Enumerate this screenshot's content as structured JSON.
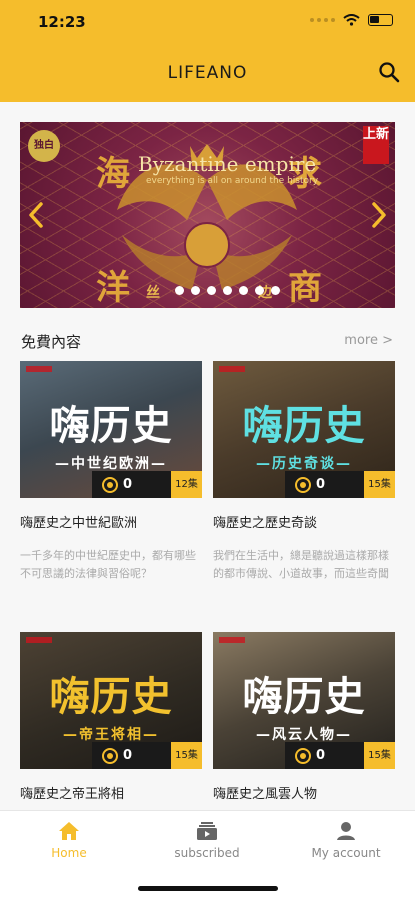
{
  "status_bar": {
    "time": "12:23"
  },
  "header": {
    "title": "LIFEANO"
  },
  "banner": {
    "title": "Byzantine empire",
    "subtitle": "everything is all on around the history",
    "chars": [
      "海",
      "求",
      "洋",
      "商"
    ],
    "small_left": "丝",
    "small_right": "边",
    "new_badge": "上新",
    "logo_text": "独白"
  },
  "section": {
    "title": "免費內容",
    "more": "more >"
  },
  "cards": [
    {
      "thumb_main": "嗨历史",
      "thumb_sub": "—中世纪欧洲—",
      "plays": "0",
      "episodes": "12集",
      "title": "嗨歷史之中世紀歐洲",
      "desc": "一千多年的中世紀歷史中，都有哪些不可思議的法律與習俗呢？"
    },
    {
      "thumb_main": "嗨历史",
      "thumb_sub": "—历史奇谈—",
      "plays": "0",
      "episodes": "15集",
      "title": "嗨歷史之歷史奇談",
      "desc": "我們在生活中，總是聽說過這樣那樣的都市傳說、小道故事，而這些奇聞軼事到底是哪裏來的，..."
    },
    {
      "thumb_main": "嗨历史",
      "thumb_sub": "—帝王将相—",
      "plays": "0",
      "episodes": "15集",
      "title": "嗨歷史之帝王將相",
      "desc": ""
    },
    {
      "thumb_main": "嗨历史",
      "thumb_sub": "—风云人物—",
      "plays": "0",
      "episodes": "15集",
      "title": "嗨歷史之風雲人物",
      "desc": ""
    }
  ],
  "tabs": [
    {
      "label": "Home",
      "icon": "home-icon"
    },
    {
      "label": "subscribed",
      "icon": "subscribed-icon"
    },
    {
      "label": "My account",
      "icon": "account-icon"
    }
  ],
  "colors": {
    "accent": "#f5bd2c"
  }
}
